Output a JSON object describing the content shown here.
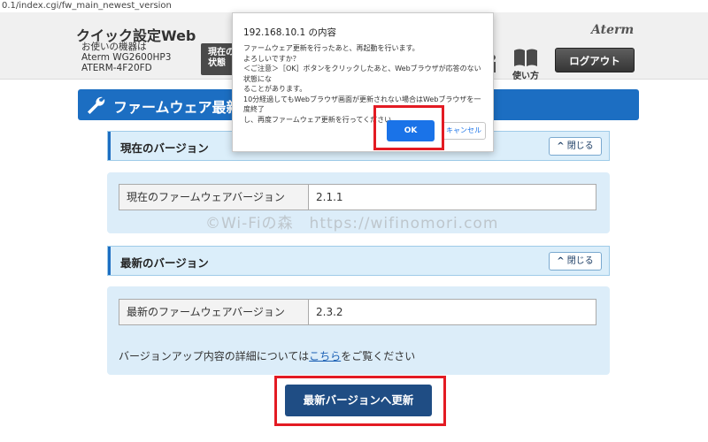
{
  "browser": {
    "url": "0.1/index.cgi/fw_main_newest_version"
  },
  "header": {
    "app_title": "クイック設定Web",
    "device_label": "お使いの機器は",
    "device_model": "Aterm WG2600HP3",
    "device_id": "ATERM-4F20FD",
    "nav_status_label": "現在の状態",
    "nav_usage_label": "使い方",
    "logout_label": "ログアウト",
    "logo": "Aterm",
    "icons": {
      "usage": "book-icon",
      "person": "person-icon"
    }
  },
  "page": {
    "title": "ファームウェア最新",
    "icon": "wrench-icon"
  },
  "current_section": {
    "title": "現在のバージョン",
    "close_label": "閉じる",
    "row_label": "現在のファームウェアバージョン",
    "row_value": "2.1.1"
  },
  "latest_section": {
    "title": "最新のバージョン",
    "close_label": "閉じる",
    "row_label": "最新のファームウェアバージョン",
    "row_value": "2.3.2",
    "note_before": "バージョンアップ内容の詳細については",
    "note_link": "こちら",
    "note_after": "をご覧ください"
  },
  "update_button": {
    "label": "最新バージョンへ更新"
  },
  "watermark": "©Wi-Fiの森　https://wifinomori.com",
  "dialog": {
    "title": "192.168.10.1 の内容",
    "lines": [
      "ファームウェア更新を行ったあと、再起動を行います。",
      "よろしいですか？",
      "＜ご注意＞［OK］ボタンをクリックしたあと、Webブラウザが応答のない状態にな",
      "ることがあります。",
      "10分経過してもWebブラウザ画面が更新されない場合はWebブラウザを一度終了",
      "し、再度ファームウェア更新を行ってください。"
    ],
    "ok_label": "OK",
    "cancel_label": "キャンセル"
  },
  "colors": {
    "title_bar": "#1c6ec2",
    "panel": "#dcedf9",
    "update_button": "#1f4d84",
    "highlight": "#e31b23",
    "dialog_ok": "#1a73e8"
  }
}
